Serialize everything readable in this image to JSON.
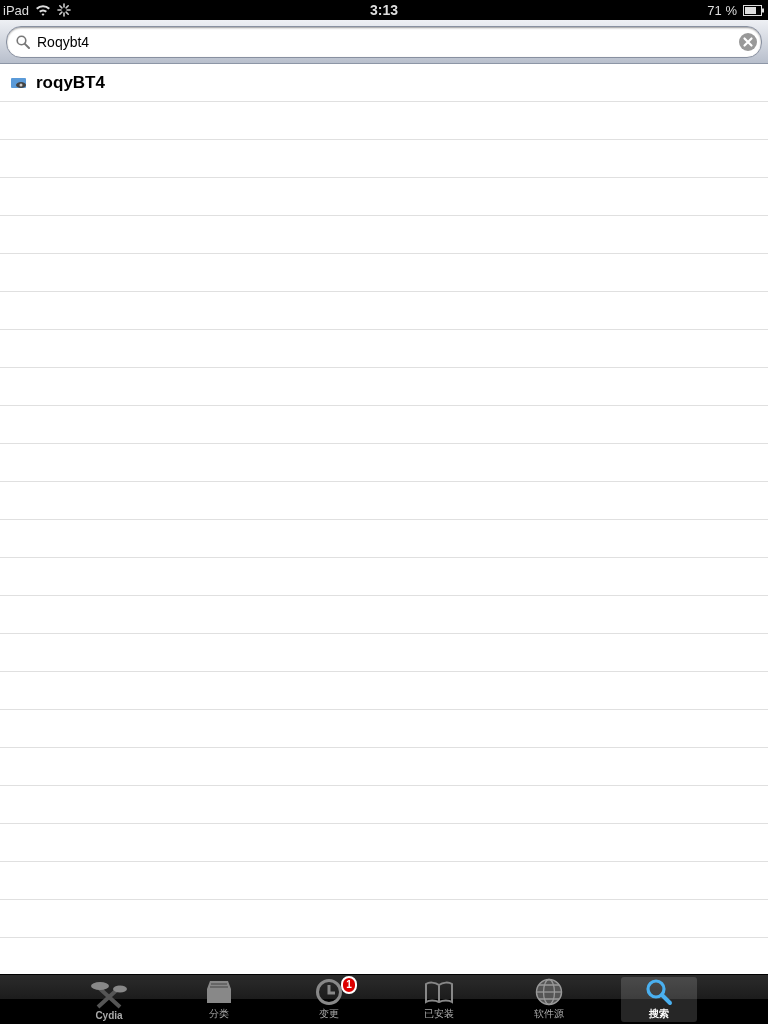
{
  "status_bar": {
    "device": "iPad",
    "time": "3:13",
    "battery": "71 %"
  },
  "search": {
    "value": "Roqybt4"
  },
  "results": [
    {
      "name": "roqyBT4"
    }
  ],
  "tabs": [
    {
      "kind": "cydia",
      "label": "Cydia",
      "selected": false
    },
    {
      "kind": "sections",
      "label": "分类",
      "selected": false
    },
    {
      "kind": "changes",
      "label": "变更",
      "selected": false,
      "badge": "1"
    },
    {
      "kind": "installed",
      "label": "已安装",
      "selected": false
    },
    {
      "kind": "sources",
      "label": "软件源",
      "selected": false
    },
    {
      "kind": "search",
      "label": "搜索",
      "selected": true
    }
  ]
}
